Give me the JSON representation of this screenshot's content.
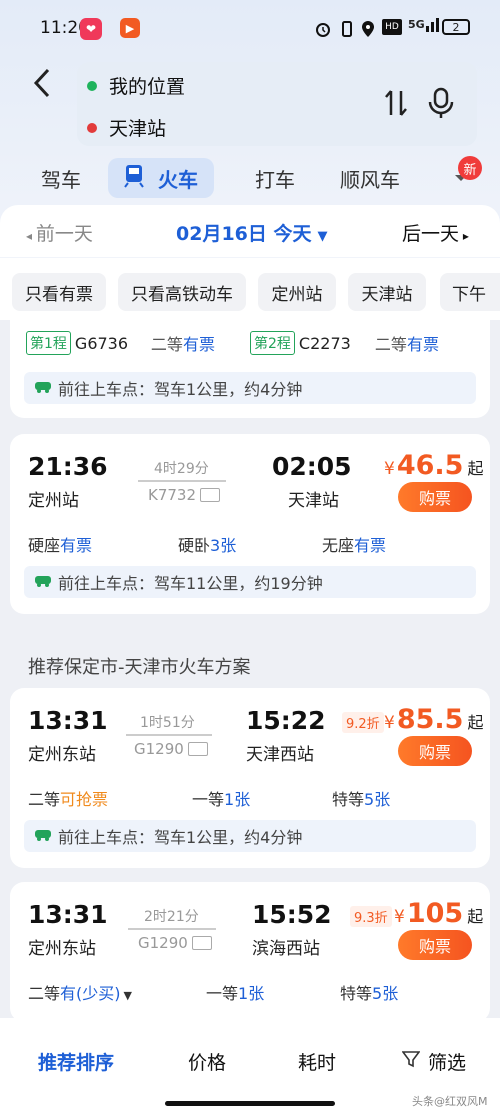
{
  "status": {
    "time": "11:20",
    "battery": "2",
    "signal": "5G",
    "hd": "HD"
  },
  "search": {
    "from": "我的位置",
    "to": "天津站"
  },
  "tabs": [
    "驾车",
    "火车",
    "打车",
    "顺风车"
  ],
  "badge": "新",
  "date": {
    "prev": "前一天",
    "current": "02月16日 今天",
    "next": "后一天"
  },
  "filters": [
    "只看有票",
    "只看高铁动车",
    "定州站",
    "天津站",
    "下午"
  ],
  "partial": {
    "leg1_tag": "第1程",
    "leg1_train": "G6736",
    "leg1_seat": "二等",
    "leg1_avail": "有票",
    "leg2_tag": "第2程",
    "leg2_train": "C2273",
    "leg2_seat": "二等",
    "leg2_avail": "有票",
    "route": "前往上车点：驾车1公里，约4分钟"
  },
  "trains": [
    {
      "dep": "21:36",
      "dep_st": "定州站",
      "dur": "4时29分",
      "no": "K7732",
      "arr": "02:05",
      "arr_st": "天津站",
      "yen": "¥",
      "price": "46.5",
      "qi": "起",
      "discount": "",
      "buy": "购票",
      "seats": [
        {
          "n": "硬座",
          "v": "有票"
        },
        {
          "n": "硬卧",
          "v": "3张"
        },
        {
          "n": "无座",
          "v": "有票"
        }
      ],
      "route": "前往上车点：驾车11公里，约19分钟"
    },
    {
      "dep": "13:31",
      "dep_st": "定州东站",
      "dur": "1时51分",
      "no": "G1290",
      "arr": "15:22",
      "arr_st": "天津西站",
      "yen": "¥",
      "price": "85.5",
      "qi": "起",
      "discount": "9.2折",
      "buy": "购票",
      "seats": [
        {
          "n": "二等",
          "v": "可抢票"
        },
        {
          "n": "一等",
          "v": "1张"
        },
        {
          "n": "特等",
          "v": "5张"
        }
      ],
      "route": "前往上车点：驾车1公里，约4分钟"
    },
    {
      "dep": "13:31",
      "dep_st": "定州东站",
      "dur": "2时21分",
      "no": "G1290",
      "arr": "15:52",
      "arr_st": "滨海西站",
      "yen": "¥",
      "price": "105",
      "qi": "起",
      "discount": "9.3折",
      "buy": "购票",
      "seats": [
        {
          "n": "二等",
          "v": "有(少买)"
        },
        {
          "n": "一等",
          "v": "1张"
        },
        {
          "n": "特等",
          "v": "5张"
        }
      ],
      "route": ""
    }
  ],
  "section": "推荐保定市-天津市火车方案",
  "bottom": [
    "推荐排序",
    "价格",
    "耗时",
    "筛选"
  ],
  "watermark": "头条@红双风M",
  "colors": {
    "accent": "#1e5fd6",
    "price": "#f25a22",
    "green": "#23a35a"
  }
}
